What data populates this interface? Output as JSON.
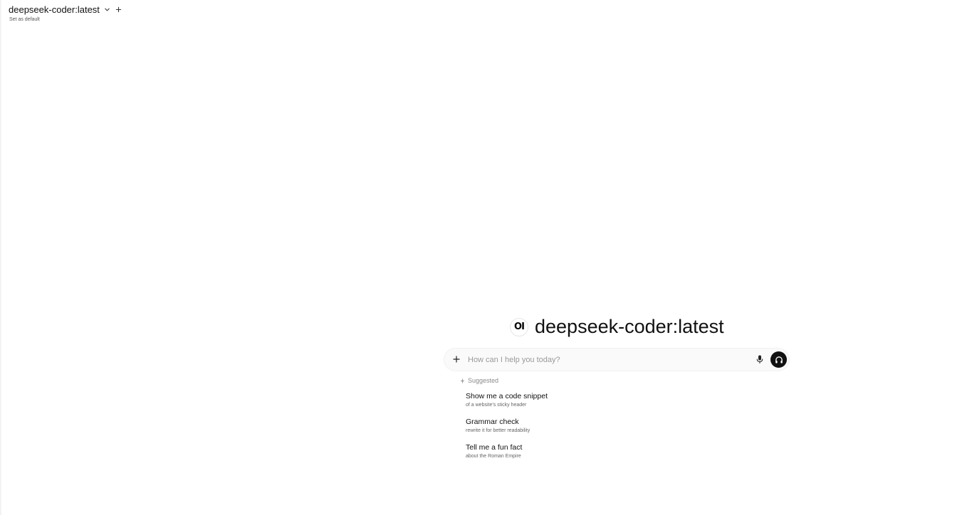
{
  "header": {
    "model_name": "deepseek-coder:latest",
    "set_default_label": "Set as default",
    "chevron_icon": "chevron-down-icon",
    "add_icon": "plus-icon"
  },
  "hero": {
    "logo_text": "OI",
    "title": "deepseek-coder:latest"
  },
  "input": {
    "placeholder": "How can I help you today?",
    "value": "",
    "attach_icon": "plus-icon",
    "mic_icon": "microphone-icon",
    "voice_icon": "headphones-icon"
  },
  "suggestions": {
    "header_label": "Suggested",
    "header_icon": "sparkle-icon",
    "items": [
      {
        "title": "Show me a code snippet",
        "subtitle": "of a website's sticky header"
      },
      {
        "title": "Grammar check",
        "subtitle": "rewrite it for better readability"
      },
      {
        "title": "Tell me a fun fact",
        "subtitle": "about the Roman Empire"
      }
    ]
  },
  "colors": {
    "background": "#ffffff",
    "text": "#111111",
    "muted": "#8a8a8a",
    "input_bg": "#fafafa",
    "voice_button_bg": "#111111"
  }
}
